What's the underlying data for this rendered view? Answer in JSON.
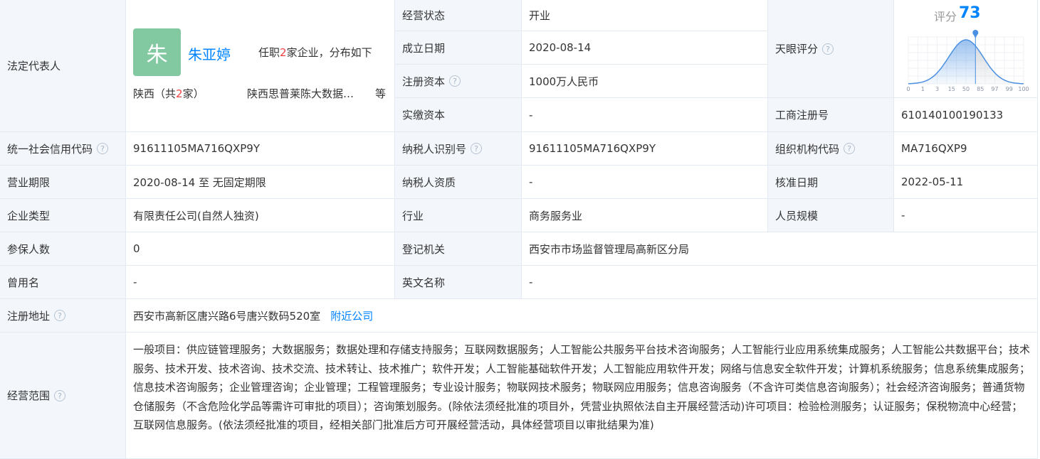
{
  "legal_rep": {
    "label": "法定代表人",
    "avatar_char": "朱",
    "name": "朱亚婷",
    "info_prefix": "任职",
    "info_count": "2",
    "info_suffix": "家企业，分布如下",
    "region_prefix": "陕西（共",
    "region_count": "2",
    "region_suffix": "家）",
    "company": "陕西思普莱陈大数据…",
    "etc": "等"
  },
  "status": {
    "label": "经营状态",
    "value": "开业"
  },
  "established": {
    "label": "成立日期",
    "value": "2020-08-14"
  },
  "reg_capital": {
    "label": "注册资本",
    "value": "1000万人民币"
  },
  "paid_capital": {
    "label": "实缴资本",
    "value": "-"
  },
  "tianyan": {
    "label": "天眼评分",
    "score_label": "评分",
    "score": "73",
    "chart_data": {
      "type": "area",
      "x_tick_labels": [
        "0",
        "1",
        "3",
        "15",
        "50",
        "85",
        "97",
        "99",
        "100"
      ],
      "marker_value": 73,
      "colors": {
        "curve": "#4a90e2",
        "marker": "#4a90e2"
      }
    }
  },
  "biz_reg_no": {
    "label": "工商注册号",
    "value": "610140100190133"
  },
  "credit_code": {
    "label": "统一社会信用代码",
    "value": "91611105MA716QXP9Y"
  },
  "taxpayer_id": {
    "label": "纳税人识别号",
    "value": "91611105MA716QXP9Y"
  },
  "org_code": {
    "label": "组织机构代码",
    "value": "MA716QXP9"
  },
  "term": {
    "label": "营业期限",
    "value": "2020-08-14 至 无固定期限"
  },
  "tax_qual": {
    "label": "纳税人资质",
    "value": "-"
  },
  "approval_date": {
    "label": "核准日期",
    "value": "2022-05-11"
  },
  "company_type": {
    "label": "企业类型",
    "value": "有限责任公司(自然人独资)"
  },
  "industry": {
    "label": "行业",
    "value": "商务服务业"
  },
  "staff_size": {
    "label": "人员规模",
    "value": "-"
  },
  "insured": {
    "label": "参保人数",
    "value": "0"
  },
  "reg_authority": {
    "label": "登记机关",
    "value": "西安市市场监督管理局高新区分局"
  },
  "former_name": {
    "label": "曾用名",
    "value": "-"
  },
  "english_name": {
    "label": "英文名称",
    "value": "-"
  },
  "address": {
    "label": "注册地址",
    "value": "西安市高新区唐兴路6号唐兴数码520室",
    "nearby_link": "附近公司"
  },
  "scope": {
    "label": "经营范围",
    "value": "一般项目：供应链管理服务；大数据服务；数据处理和存储支持服务；互联网数据服务；人工智能公共服务平台技术咨询服务；人工智能行业应用系统集成服务；人工智能公共数据平台；技术服务、技术开发、技术咨询、技术交流、技术转让、技术推广；软件开发；人工智能基础软件开发；人工智能应用软件开发；网络与信息安全软件开发；计算机系统服务；信息系统集成服务；信息技术咨询服务；企业管理咨询；企业管理；工程管理服务；专业设计服务；物联网技术服务；物联网应用服务；信息咨询服务（不含许可类信息咨询服务）；社会经济咨询服务；普通货物仓储服务（不含危险化学品等需许可审批的项目）；咨询策划服务。(除依法须经批准的项目外，凭营业执照依法自主开展经营活动)许可项目：检验检测服务；认证服务；保税物流中心经营；互联网信息服务。(依法须经批准的项目，经相关部门批准后方可开展经营活动，具体经营项目以审批结果为准)"
  },
  "icons": {
    "help": "question-circle-icon"
  }
}
